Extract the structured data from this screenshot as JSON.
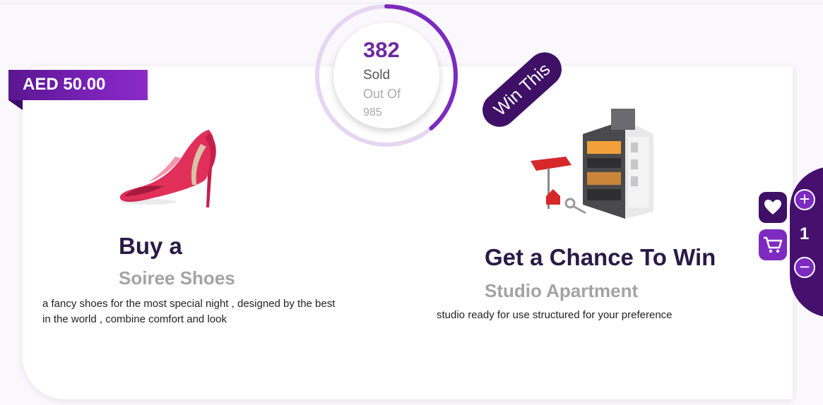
{
  "product": {
    "price": "AED 50.00",
    "buy_heading": "Buy a",
    "buy_item": "Soiree Shoes",
    "buy_description": "a fancy shoes for the most special night , designed by the best in the world , combine comfort and look"
  },
  "campaign": {
    "sold_count": "382",
    "sold_label": "Sold",
    "out_of_label": "Out Of",
    "total": "985",
    "sold_fraction": 0.388,
    "badge": "Win This",
    "win_heading": "Get a Chance To Win",
    "win_item": "Studio Apartment",
    "win_description": "studio ready for use structured for your preference"
  },
  "cart": {
    "quantity": "1",
    "plus_symbol": "+",
    "minus_symbol": "−"
  },
  "icons": {
    "favorite": "heart-icon",
    "cart": "cart-icon",
    "product_image": "high-heel-shoe",
    "prize_image": "apartment-building"
  },
  "colors": {
    "primary_purple": "#7d2ac0",
    "dark_purple": "#3f1166",
    "ring_light": "#e6d6f2"
  }
}
